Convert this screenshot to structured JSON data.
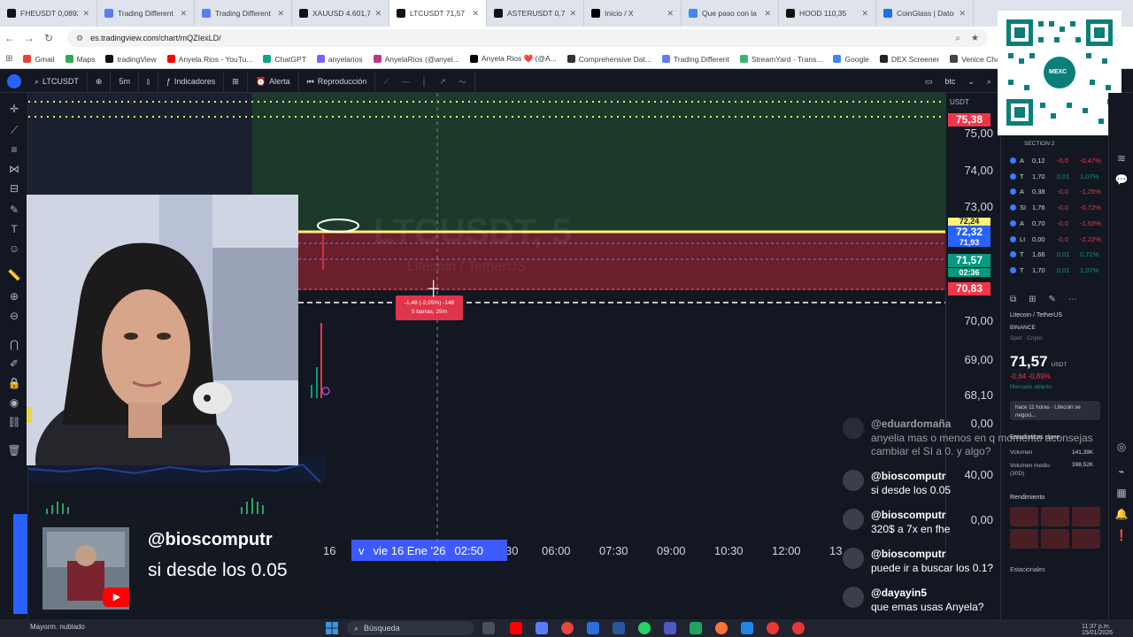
{
  "browser": {
    "tabs": [
      {
        "label": "FHEUSDT 0,08921",
        "color": "#111111"
      },
      {
        "label": "Trading Different",
        "color": "#5b7cfa"
      },
      {
        "label": "Trading Different",
        "color": "#5b7cfa"
      },
      {
        "label": "XAUUSD 4.601,7",
        "color": "#111111"
      },
      {
        "label": "LTCUSDT 71,57",
        "color": "#111111"
      },
      {
        "label": "ASTERUSDT 0,707",
        "color": "#111111"
      },
      {
        "label": "Inicio / X",
        "color": "#000000"
      },
      {
        "label": "Que paso con la",
        "color": "#4285f4"
      },
      {
        "label": "HOOD 110,35",
        "color": "#111111"
      },
      {
        "label": "CoinGlass | Datos",
        "color": "#1a73e8"
      }
    ],
    "url": "es.tradingview.com/chart/mQZIexLD/",
    "bookmarks": [
      {
        "label": "Gmail",
        "color": "#ea4335"
      },
      {
        "label": "Maps",
        "color": "#34a853"
      },
      {
        "label": "tradingView",
        "color": "#111111"
      },
      {
        "label": "Anyela Rios - YouTu...",
        "color": "#ff0000"
      },
      {
        "label": "ChatGPT",
        "color": "#10a37f"
      },
      {
        "label": "anyelarios",
        "color": "#7b61ff"
      },
      {
        "label": "AnyelaRios (@anyel...",
        "color": "#c13584"
      },
      {
        "label": "Anyela Rios ❤️ (@A...",
        "color": "#000000"
      },
      {
        "label": "Comprehensive Dat...",
        "color": "#333333"
      },
      {
        "label": "Trading Different",
        "color": "#5b7cfa"
      },
      {
        "label": "StreamYard - Trans...",
        "color": "#3cb371"
      },
      {
        "label": "Google",
        "color": "#4285f4"
      },
      {
        "label": "DEX Screener",
        "color": "#222222"
      },
      {
        "label": "Venice Chat - Ve",
        "color": "#444444"
      }
    ]
  },
  "toolbar": {
    "symbol": "LTCUSDT",
    "interval": "5m",
    "indicators": "Indicadores",
    "alert": "Alerta",
    "replay": "Reproducción",
    "btc_label": "btc"
  },
  "chart": {
    "watermark_symbol": "LTCUSDT, 5",
    "watermark_name": "Litecoin / TetherUS",
    "measure_label_1": "-1,48 (-2,05%) -148",
    "measure_label_2": "5 barras, 25m",
    "price_labels": [
      "75,00",
      "74,00",
      "73,00",
      "70,00",
      "69,00",
      "68,10",
      "0,00",
      "40,00",
      "0,00"
    ],
    "price_tags": [
      {
        "value": "75,38",
        "color": "#f23645"
      },
      {
        "value": "72,32",
        "color": "#2962ff"
      },
      {
        "value": "71,57",
        "color": "#089981"
      },
      {
        "value": "70,83",
        "color": "#f23645"
      }
    ],
    "hidden_tags": [
      "72,24",
      "71,93",
      "02:36"
    ],
    "axis_currency": "USDT",
    "time_tag_prefix": "v",
    "time_tag_date": "vie 16 Ene '26",
    "time_tag_time": "02:50",
    "time_labels": [
      "16",
      "30",
      "06:00",
      "07:30",
      "09:00",
      "10:30",
      "12:00",
      "13"
    ]
  },
  "overlay": {
    "name": "@bioscomputr",
    "message": "si desde los 0.05"
  },
  "qr": {
    "brand": "MEXC"
  },
  "right_panel": {
    "section": "SECTION 2",
    "watchlist": [
      {
        "sym": "A",
        "price": "0,12",
        "chg": "-0,0",
        "pct": "-0,47%",
        "color": "#f23645"
      },
      {
        "sym": "T",
        "price": "1,70",
        "chg": "0,01",
        "pct": "1,07%",
        "color": "#089981"
      },
      {
        "sym": "A",
        "price": "0,38",
        "chg": "-0,0",
        "pct": "-1,25%",
        "color": "#f23645"
      },
      {
        "sym": "SI",
        "price": "1,76",
        "chg": "-0,0",
        "pct": "-0,72%",
        "color": "#f23645"
      },
      {
        "sym": "A",
        "price": "0,70",
        "chg": "-0,0",
        "pct": "-1,53%",
        "color": "#f23645"
      },
      {
        "sym": "LI",
        "price": "0,00",
        "chg": "-0,0",
        "pct": "-2,22%",
        "color": "#f23645"
      },
      {
        "sym": "T",
        "price": "1,66",
        "chg": "0,01",
        "pct": "0,71%",
        "color": "#089981"
      },
      {
        "sym": "T",
        "price": "1,70",
        "chg": "0,01",
        "pct": "1,07%",
        "color": "#089981"
      }
    ],
    "asset_name": "Litecoin / TetherUS",
    "exchange": "BINANCE",
    "market_type": "Spot · Cripto",
    "price": "71,57",
    "currency": "USDT",
    "change": "-0,64  -0,89%",
    "market_status": "Mercado abierto",
    "news": "hace 11 horas · Litecoin se negoci...",
    "stats_title": "Estadísticas clave",
    "volume_label": "Volumen",
    "volume_value": "141,39K",
    "avg_volume_label": "Volumen medio (30D)",
    "avg_volume_value": "398,52K",
    "performance": "Rendimiento",
    "seasonals": "Estacionales"
  },
  "chat": [
    {
      "name": "@eduardomaña",
      "message": "anyelia mas o menos en q momento aconsejas cambiar el SI a 0. y algo?"
    },
    {
      "name": "@bioscomputr",
      "message": "si desde los 0.05"
    },
    {
      "name": "@bioscomputr",
      "message": "320$ a 7x en fhe"
    },
    {
      "name": "@bioscomputr",
      "message": "puede ir a buscar los 0.1?"
    },
    {
      "name": "@dayayin5",
      "message": "que emas usas Anyela?"
    }
  ],
  "taskbar": {
    "weather": "Mayorm. nublado",
    "search": "Búsqueda",
    "clock_time": "11:37 p.m.",
    "clock_date": "15/01/2026"
  }
}
